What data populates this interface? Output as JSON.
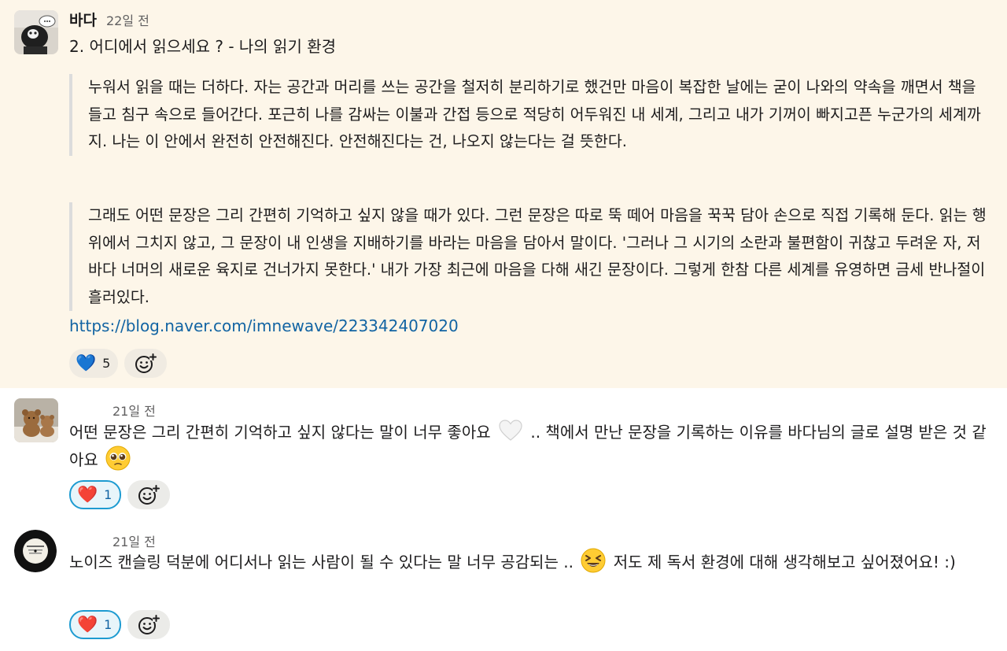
{
  "main": {
    "author": "바다",
    "time": "22일 전",
    "title": "2. 어디에서 읽으세요 ? - 나의 읽기 환경",
    "quote1": "누워서 읽을 때는 더하다. 자는 공간과 머리를 쓰는 공간을 철저히 분리하기로 했건만 마음이 복잡한 날에는 굳이 나와의 약속을 깨면서 책을 들고 침구 속으로 들어간다. 포근히 나를 감싸는 이불과 간접 등으로 적당히 어두워진 내 세계, 그리고 내가 기꺼이 빠지고픈 누군가의 세계까지. 나는 이 안에서 완전히 안전해진다. 안전해진다는 건, 나오지 않는다는 걸 뜻한다.",
    "quote2": "그래도 어떤 문장은 그리 간편히 기억하고 싶지 않을 때가 있다. 그런 문장은 따로 뚝 떼어 마음을 꾹꾹 담아 손으로 직접 기록해 둔다. 읽는 행위에서 그치지 않고, 그 문장이 내 인생을 지배하기를 바라는 마음을 담아서 말이다. '그러나 그 시기의 소란과 불편함이 귀찮고 두려운 자, 저 바다 너머의 새로운 육지로 건너가지 못한다.' 내가 가장 최근에 마음을 다해 새긴 문장이다. 그렇게 한참 다른 세계를 유영하면 금세 반나절이 흘러있다.",
    "link": "https://blog.naver.com/imnewave/223342407020",
    "reaction": {
      "emoji": "💙",
      "count": "5"
    }
  },
  "reply1": {
    "time": "21일 전",
    "text_before": "어떤 문장은 그리 간편히 기억하고 싶지 않다는 말이 너무 좋아요",
    "text_middle": " .. 책에서 만난 문장을 기록하는 이유를 바다님의 글로 설명 받은 것 같아요",
    "emoji_1": "white-heart-emoji",
    "emoji_2": "pleading-face-emoji",
    "reaction": {
      "emoji": "❤️",
      "count": "1"
    }
  },
  "reply2": {
    "time": "21일 전",
    "text_before": "노이즈 캔슬링 덕분에 어디서나 읽는 사람이 될 수 있다는 말 너무 공감되는 ..",
    "text_after": " 저도 제 독서 환경에 대해 생각해보고 싶어졌어요! :)",
    "emoji_1": "grinning-squinting-face-emoji",
    "reaction": {
      "emoji": "❤️",
      "count": "1"
    }
  },
  "colors": {
    "highlight_bg": "#fdf6e9",
    "link": "#1264a3",
    "active_reaction": "#1d9bd1"
  }
}
